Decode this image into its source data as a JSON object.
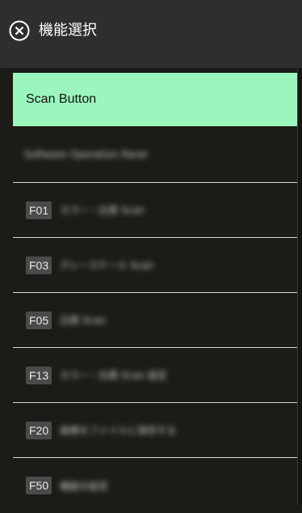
{
  "header": {
    "title": "機能選択",
    "close_icon": "close-circle-icon"
  },
  "colors": {
    "header_bg": "#2e2e2e",
    "list_bg": "#1b1b17",
    "selected_bg": "#9af6bc",
    "badge_bg": "#4a4a4a",
    "divider": "#d7d7d7"
  },
  "list": {
    "selected": {
      "label": "Scan Button"
    },
    "plain": {
      "label": "Software Operation Panel"
    },
    "items": [
      {
        "code": "F01",
        "label": "カラー・白黒 Scan"
      },
      {
        "code": "F03",
        "label": "グレースケール Scan"
      },
      {
        "code": "F05",
        "label": "白黒 Scan"
      },
      {
        "code": "F13",
        "label": "カラー・白黒 Scan 設定"
      },
      {
        "code": "F20",
        "label": "画像をファイルに保存する"
      },
      {
        "code": "F50",
        "label": "機能の設定"
      }
    ]
  }
}
